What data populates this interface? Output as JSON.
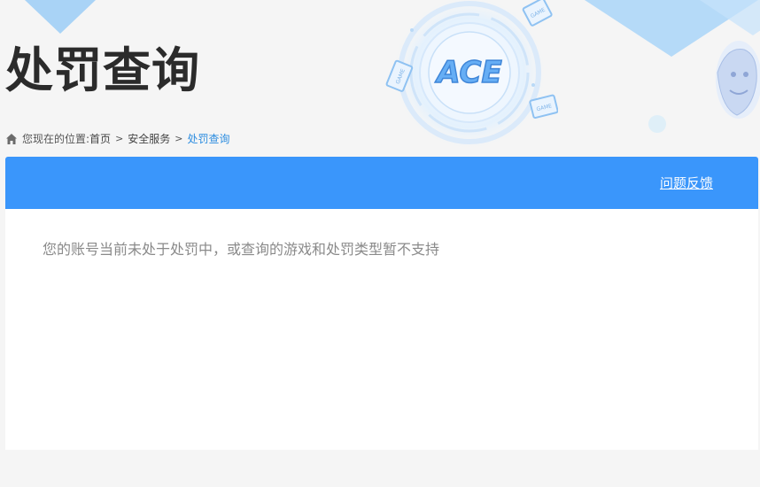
{
  "header": {
    "title": "处罚查询",
    "logo_text": "ACE",
    "game_badge": "GAME"
  },
  "breadcrumb": {
    "prefix": "您现在的位置:",
    "items": [
      {
        "label": "首页"
      },
      {
        "label": "安全服务"
      },
      {
        "label": "处罚查询"
      }
    ],
    "separator": ">"
  },
  "panel": {
    "feedback_label": "问题反馈",
    "message": "您的账号当前未处于处罚中，或查询的游戏和处罚类型暂不支持"
  },
  "colors": {
    "accent": "#3a96fb",
    "breadcrumb_current": "#2d8de0",
    "background": "#f5f5f5"
  }
}
